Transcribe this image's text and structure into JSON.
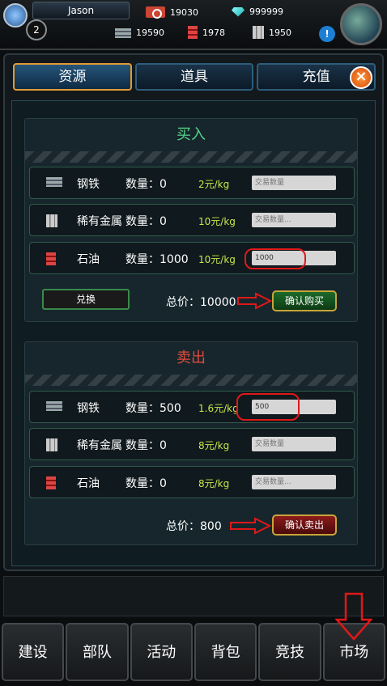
{
  "player": {
    "name": "Jason",
    "level": "2"
  },
  "resources": {
    "ticket": "19030",
    "diamond": "999999",
    "steel": "19590",
    "oil": "1978",
    "metal": "1950"
  },
  "tabs": [
    "资源",
    "道具",
    "充值"
  ],
  "buy": {
    "title": "买入",
    "rows": [
      {
        "name": "钢铁",
        "qty": "数量：0",
        "price": "2元/kg",
        "value": "",
        "placeholder": "交易数量"
      },
      {
        "name": "稀有金属",
        "qty": "数量：0",
        "price": "10元/kg",
        "value": "",
        "placeholder": "交易数量..."
      },
      {
        "name": "石油",
        "qty": "数量：1000",
        "price": "10元/kg",
        "value": "1000",
        "placeholder": ""
      }
    ],
    "exchange_label": "兑换",
    "total": "总价：10000",
    "confirm_label": "确认购买"
  },
  "sell": {
    "title": "卖出",
    "rows": [
      {
        "name": "钢铁",
        "qty": "数量：500",
        "price": "1.6元/kg",
        "value": "500",
        "placeholder": ""
      },
      {
        "name": "稀有金属",
        "qty": "数量：0",
        "price": "8元/kg",
        "value": "",
        "placeholder": "交易数量"
      },
      {
        "name": "石油",
        "qty": "数量：0",
        "price": "8元/kg",
        "value": "",
        "placeholder": "交易数量..."
      }
    ],
    "total": "总价：800",
    "confirm_label": "确认卖出"
  },
  "nav": [
    "建设",
    "部队",
    "活动",
    "背包",
    "竞技",
    "市场"
  ],
  "colors": {
    "buy_title": "#55d68a",
    "sell_title": "#e24a3a",
    "price": "#c6e84a",
    "highlight": "#e01818"
  }
}
